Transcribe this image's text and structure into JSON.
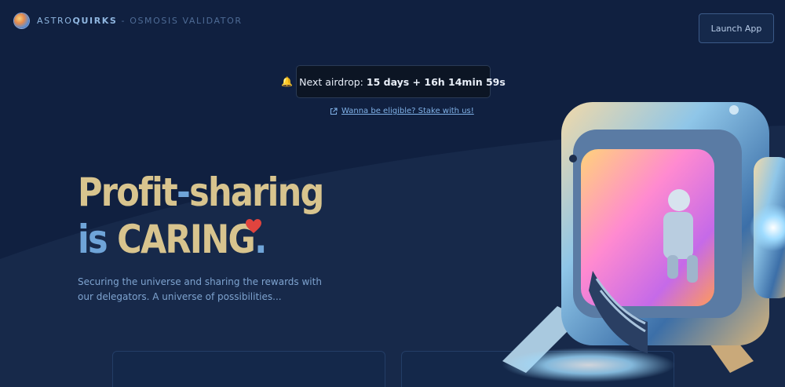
{
  "header": {
    "brand_prefix": "ASTRO",
    "brand_bold": "QUIRKS",
    "brand_suffix": " - OSMOSIS VALIDATOR",
    "launch_label": "Launch App"
  },
  "airdrop": {
    "bell_icon": "bell-icon",
    "label": "Next airdrop:",
    "countdown": "15 days + 16h 14min 59s"
  },
  "stake_link": {
    "icon": "external-link-icon",
    "text": "Wanna be eligible? Stake with us!"
  },
  "hero": {
    "line1_a": "Profit",
    "line1_dash": "-",
    "line1_b": "sharing",
    "line2_a": "is ",
    "line2_b": "CARING",
    "line2_dot": ".",
    "subtitle": "Securing the universe and sharing the rewards with our delegators. A universe of possibilities..."
  },
  "colors": {
    "background": "#102040",
    "gold": "#d8c48e",
    "blue": "#6fa4d8",
    "heart": "#e0443e"
  }
}
